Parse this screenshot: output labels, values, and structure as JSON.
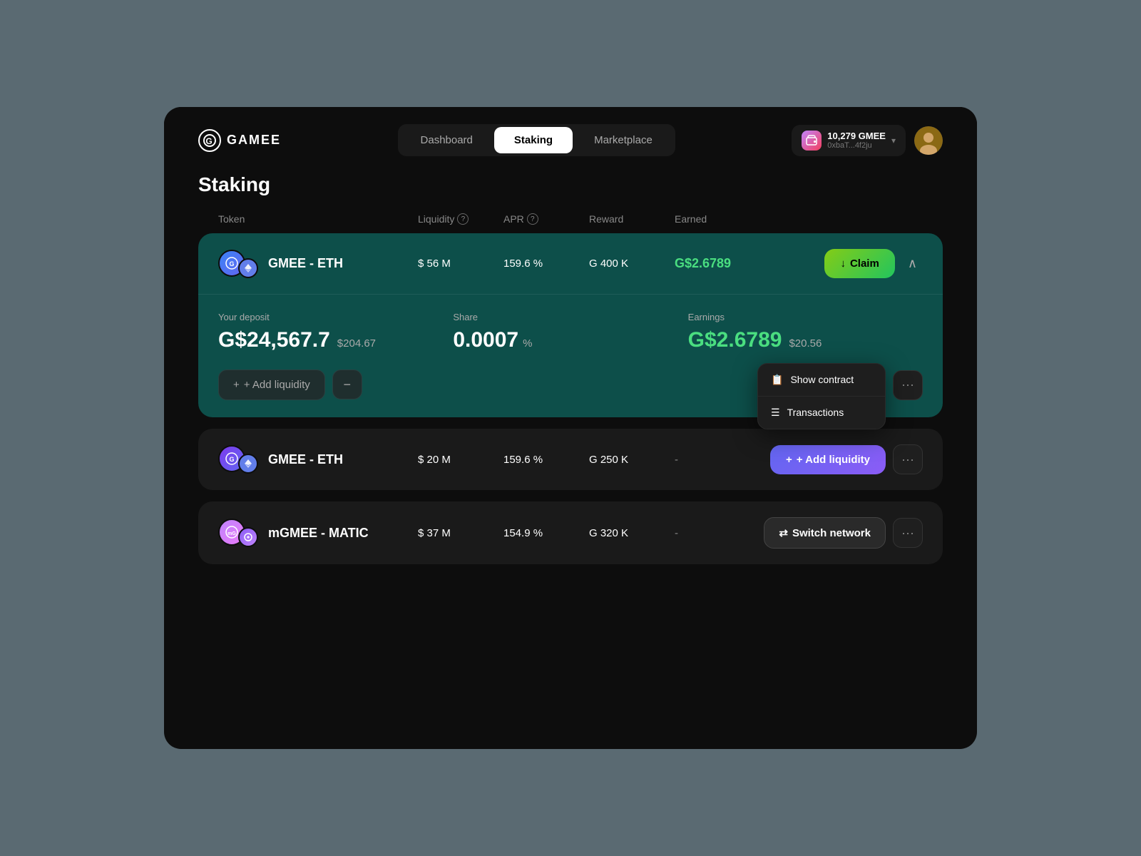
{
  "app": {
    "logo_text": "GAMEE",
    "logo_letter": "G"
  },
  "header": {
    "nav": {
      "tabs": [
        {
          "id": "dashboard",
          "label": "Dashboard",
          "active": false
        },
        {
          "id": "staking",
          "label": "Staking",
          "active": true
        },
        {
          "id": "marketplace",
          "label": "Marketplace",
          "active": false
        }
      ]
    },
    "wallet": {
      "balance": "10,279 GMEE",
      "address": "0xbaT...4f2ju",
      "chevron": "▾"
    }
  },
  "page": {
    "title": "Staking"
  },
  "table": {
    "headers": [
      {
        "id": "token",
        "label": "Token",
        "has_info": false
      },
      {
        "id": "liquidity",
        "label": "Liquidity",
        "has_info": true
      },
      {
        "id": "apr",
        "label": "APR",
        "has_info": true
      },
      {
        "id": "reward",
        "label": "Reward",
        "has_info": false
      },
      {
        "id": "earned",
        "label": "Earned",
        "has_info": false
      }
    ]
  },
  "staking_rows": [
    {
      "id": "row1",
      "token_name": "GMEE - ETH",
      "liquidity": "$ 56 M",
      "apr": "159.6 %",
      "reward": "G 400 K",
      "earned": "G$2.6789",
      "earned_color": "green",
      "expanded": true,
      "action": "claim",
      "action_label": "Claim",
      "deposit_label": "Your deposit",
      "deposit_value": "G$24,567.7",
      "deposit_usd": "$204.67",
      "share_label": "Share",
      "share_value": "0.0007",
      "share_unit": "%",
      "earnings_label": "Earnings",
      "earnings_value": "G$2.6789",
      "earnings_usd": "$20.56",
      "add_liquidity_label": "+ Add liquidity",
      "remove_label": "−",
      "more_label": "···",
      "context_menu": {
        "show": true,
        "items": [
          {
            "id": "show-contract",
            "label": "Show contract",
            "icon": "📋"
          },
          {
            "id": "transactions",
            "label": "Transactions",
            "icon": "≡"
          }
        ]
      }
    },
    {
      "id": "row2",
      "token_name": "GMEE - ETH",
      "liquidity": "$ 20 M",
      "apr": "159.6 %",
      "reward": "G 250 K",
      "earned": "-",
      "expanded": false,
      "action": "add_liquidity",
      "action_label": "+ Add liquidity",
      "more_label": "···"
    },
    {
      "id": "row3",
      "token_name": "mGMEE - MATIC",
      "liquidity": "$ 37 M",
      "apr": "154.9 %",
      "reward": "G 320 K",
      "earned": "-",
      "expanded": false,
      "action": "switch_network",
      "action_label": "Switch network",
      "more_label": "···"
    }
  ],
  "icons": {
    "claim_arrow": "↓",
    "plus": "+",
    "switch": "⇄",
    "contract": "📋",
    "transactions": "☰",
    "chevron_up": "∧",
    "chevron_down": "∨"
  }
}
